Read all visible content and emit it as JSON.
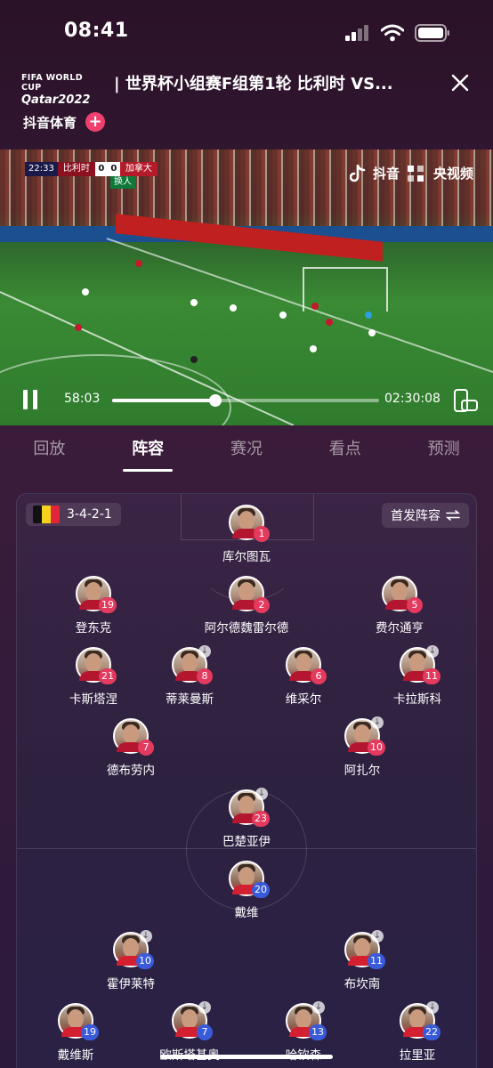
{
  "status_bar": {
    "time": "08:41"
  },
  "header": {
    "logo_line1": "FIFA WORLD CUP",
    "logo_line2": "Qatar2022",
    "title": "| 世界杯小组赛F组第1轮 比利时 VS...",
    "close_icon": "close-icon",
    "channel": "抖音体育",
    "follow_label": "+"
  },
  "video": {
    "scoreboard": {
      "clock": "22:33",
      "home": "比利时",
      "home_score": "0",
      "away_score": "0",
      "away": "加拿大",
      "sub_text": "换人"
    },
    "brand1": "抖音",
    "brand2": "央视频",
    "current_time": "58:03",
    "total_time": "02:30:08",
    "progress": 0.388
  },
  "tabs": [
    {
      "label": "回放"
    },
    {
      "label": "阵容"
    },
    {
      "label": "赛况"
    },
    {
      "label": "看点"
    },
    {
      "label": "预测"
    }
  ],
  "active_tab": "阵容",
  "lineup": {
    "formation": "3-4-2-1",
    "flag_colors": [
      "#111111",
      "#f5d21b",
      "#e2263a"
    ],
    "switch_label": "首发阵容",
    "switch_icon": "swap-icon",
    "players": [
      {
        "name": "库尔图瓦",
        "number": "1",
        "team": "home",
        "sub": false
      },
      {
        "name": "登东克",
        "number": "19",
        "team": "home",
        "sub": false
      },
      {
        "name": "阿尔德魏雷尔德",
        "number": "2",
        "team": "home",
        "sub": false
      },
      {
        "name": "费尔通亨",
        "number": "5",
        "team": "home",
        "sub": false
      },
      {
        "name": "卡斯塔涅",
        "number": "21",
        "team": "home",
        "sub": false
      },
      {
        "name": "蒂莱曼斯",
        "number": "8",
        "team": "home",
        "sub": true
      },
      {
        "name": "维采尔",
        "number": "6",
        "team": "home",
        "sub": false
      },
      {
        "name": "卡拉斯科",
        "number": "11",
        "team": "home",
        "sub": true
      },
      {
        "name": "德布劳内",
        "number": "7",
        "team": "home",
        "sub": false
      },
      {
        "name": "阿扎尔",
        "number": "10",
        "team": "home",
        "sub": true
      },
      {
        "name": "巴楚亚伊",
        "number": "23",
        "team": "home",
        "sub": true
      },
      {
        "name": "戴维",
        "number": "20",
        "team": "away",
        "sub": false
      },
      {
        "name": "霍伊莱特",
        "number": "10",
        "team": "away",
        "sub": true
      },
      {
        "name": "布坎南",
        "number": "11",
        "team": "away",
        "sub": true
      },
      {
        "name": "戴维斯",
        "number": "19",
        "team": "away",
        "sub": false
      },
      {
        "name": "欧斯塔基奥",
        "number": "7",
        "team": "away",
        "sub": true
      },
      {
        "name": "哈钦森",
        "number": "13",
        "team": "away",
        "sub": true
      },
      {
        "name": "拉里亚",
        "number": "22",
        "team": "away",
        "sub": true
      }
    ]
  }
}
